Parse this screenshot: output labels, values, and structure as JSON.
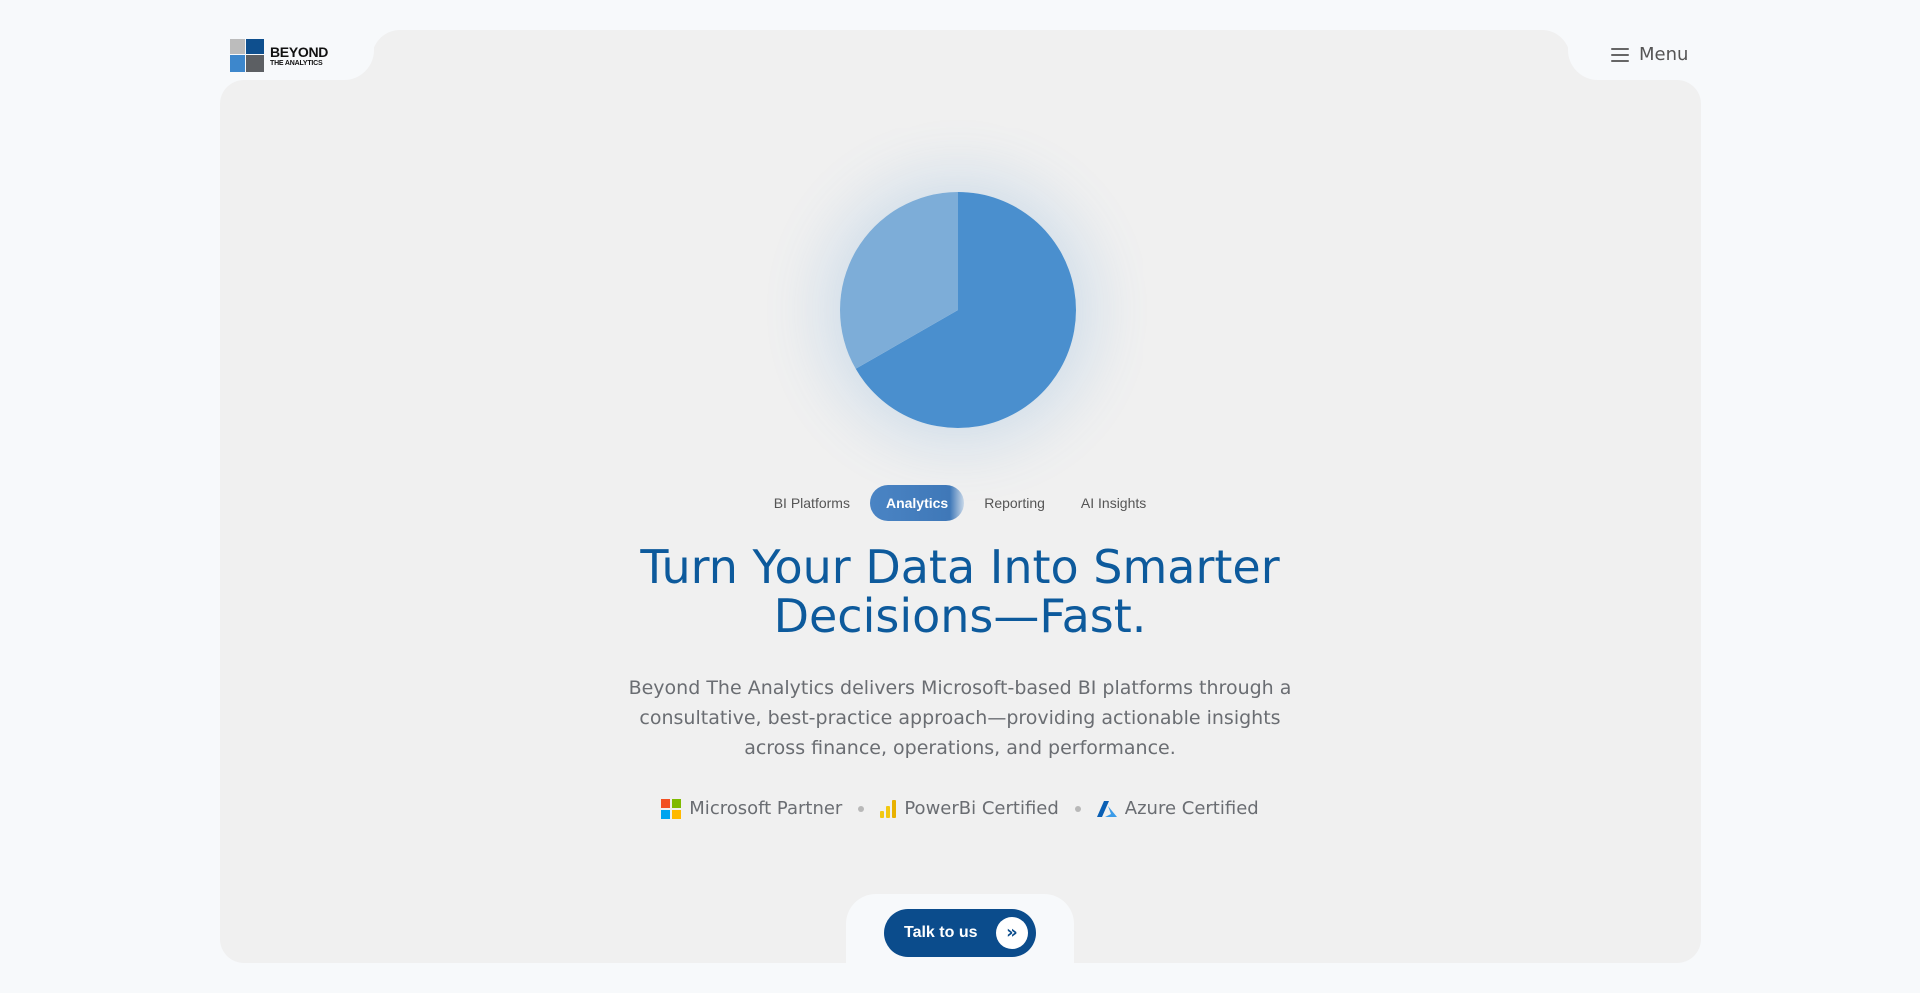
{
  "header": {
    "logo_line1": "BEYOND",
    "logo_line2": "THE ANALYTICS",
    "menu_label": "Menu"
  },
  "hero": {
    "visual": {
      "slices": [
        {
          "value": 66.7,
          "color": "#4a8fce"
        },
        {
          "value": 33.3,
          "color": "#7dadd8"
        }
      ]
    },
    "tabs": [
      {
        "label": "BI Platforms",
        "active": false
      },
      {
        "label": "Analytics",
        "active": true
      },
      {
        "label": "Reporting",
        "active": false
      },
      {
        "label": "AI Insights",
        "active": false
      }
    ],
    "headline_line1": "Turn Your Data Into Smarter",
    "headline_line2": "Decisions—Fast.",
    "description": "Beyond The Analytics delivers Microsoft-based BI platforms through a consultative, best-practice approach—providing actionable insights across finance, operations, and performance.",
    "certifications": [
      {
        "label": "Microsoft Partner",
        "icon": "microsoft-logo-icon"
      },
      {
        "label": "PowerBi Certified",
        "icon": "powerbi-icon"
      },
      {
        "label": "Azure Certified",
        "icon": "azure-icon"
      }
    ],
    "cta_label": "Talk to us",
    "cta_icon": "double-chevron-right-icon"
  },
  "colors": {
    "brand": "#0b4c8c",
    "headline": "#0d5a9c",
    "card_bg": "#f0f0f0",
    "page_bg": "#f7f9fb"
  }
}
